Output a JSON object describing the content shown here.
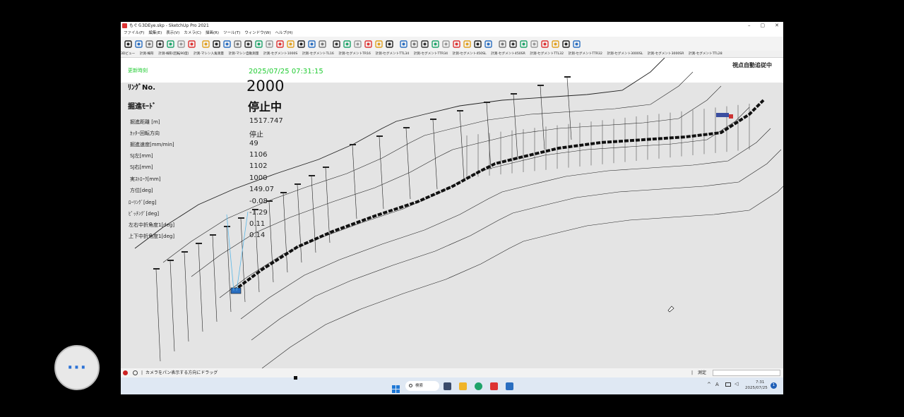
{
  "window": {
    "title": "もぐら3DEye.skp - SketchUp Pro 2021",
    "minimize": "–",
    "maximize": "▢",
    "close": "✕"
  },
  "menu": [
    "ファイル(F)",
    "編集(E)",
    "表示(V)",
    "カメラ(C)",
    "描画(R)",
    "ツール(T)",
    "ウィンドウ(W)",
    "ヘルプ(H)"
  ],
  "toolbar_icons": [
    "select-arrow",
    "3d-view",
    "orbit",
    "pan",
    "record",
    "gear-red",
    "target-red",
    "target-gray",
    "left-view",
    "orbit-yellow",
    "zoom",
    "zoom-window",
    "zoom-extents",
    "search",
    "figure",
    "footprint",
    "walk",
    "layer-blue",
    "text-a",
    "text-a-gray",
    "circle-gray",
    "palette",
    "seg-1",
    "seg-2",
    "seg-3",
    "play-green",
    "pause",
    "grid-green",
    "grid-green-2",
    "box-a",
    "box-x",
    "box-red",
    "box-b",
    "box-c",
    "box-d",
    "gear-gray",
    "hand-gray",
    "box-gray",
    "gray-square",
    "blue-circle",
    "clock",
    "speaker"
  ],
  "tabs": [
    "3Dビュー",
    "計測-線形",
    "計測-線形(回転90度)",
    "計測-マシン入角測量",
    "計測-マシン自動測量",
    "計測-セグメント1000S",
    "計測-セグメントTL16",
    "計測-セグメントTR16",
    "計測-セグメントTTL34",
    "計測-セグメントTTR34",
    "計測-セグメント450SL",
    "計測-セグメント450SR",
    "計測-セグメントTTL32",
    "計測-セグメントTTR32",
    "計測-セグメント3000SL",
    "計測-セグメント3000SR",
    "計測-セグメントTTL28"
  ],
  "hud": {
    "update_label": "更新時刻",
    "update_time": "2025/07/25 07:31:15",
    "auto_follow": "視点自動追従中",
    "ring_label": "ﾘﾝｸﾞNo.",
    "ring_value": "2000",
    "mode_label": "掘進ﾓｰﾄﾞ",
    "mode_value": "停止中",
    "rows": [
      {
        "label": "掘進距離 [m]",
        "value": "1517.747"
      },
      {
        "label": "ｶｯﾀｰ回転方向",
        "value": "停止"
      },
      {
        "label": "掘進速度[mm/min]",
        "value": "49"
      },
      {
        "label": "SJ左[mm]",
        "value": "1106"
      },
      {
        "label": "SJ右[mm]",
        "value": "1102"
      },
      {
        "label": "実ｽﾄﾛｰｸ[mm]",
        "value": "1000"
      },
      {
        "label": "方位[deg]",
        "value": "149.07"
      },
      {
        "label": "ﾛｰﾘﾝｸﾞ[deg]",
        "value": "-0.08"
      },
      {
        "label": "ﾋﾟｯﾁﾝｸﾞ[deg]",
        "value": "-1.29"
      },
      {
        "label": "左右中折角度1[deg]",
        "value": "0.11"
      },
      {
        "label": "上下中折角度1[deg]",
        "value": "0.14"
      }
    ]
  },
  "status": {
    "hint": "カメラをパン表示する方向にドラッグ",
    "measure_label": "測定"
  },
  "taskbar": {
    "search": "検索",
    "time": "7:31",
    "date": "2025/07/25",
    "lang": "A",
    "badge": "1"
  },
  "fab_label": "···",
  "colors": {
    "accent_green": "#22cc33",
    "taskbar": "#dfe8f3"
  }
}
